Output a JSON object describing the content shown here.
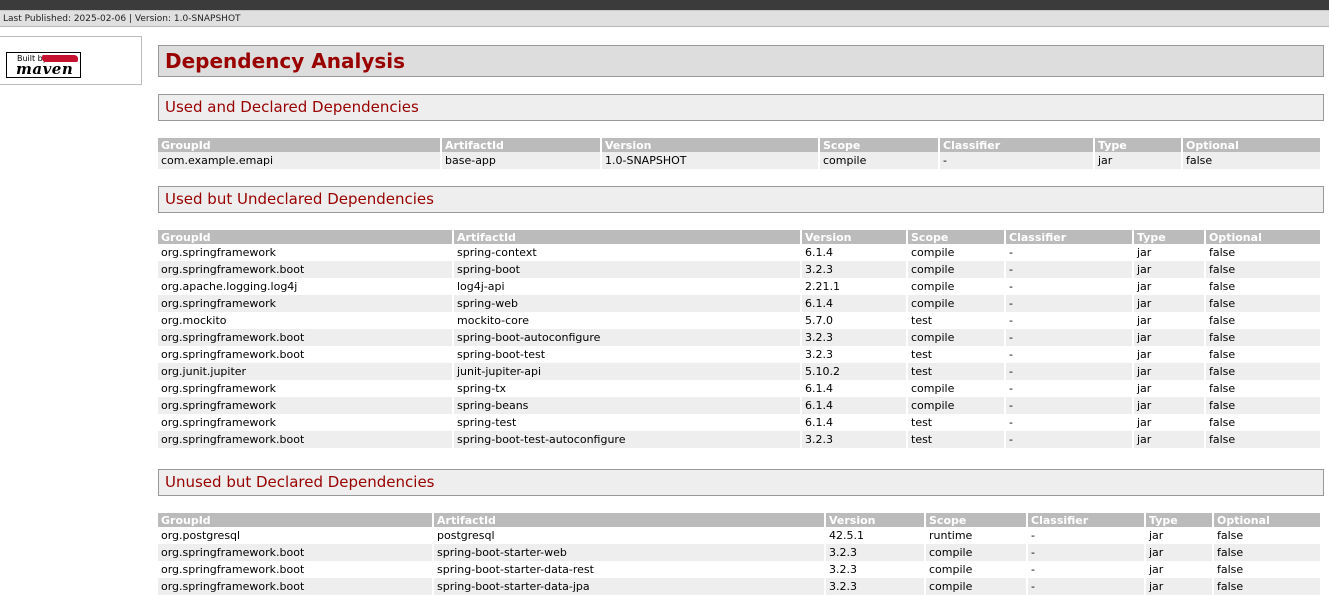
{
  "header": {
    "published": "Last Published: 2025-02-06 | Version: 1.0-SNAPSHOT"
  },
  "badge": {
    "built_by": "Built by:",
    "word": "maven"
  },
  "page_title": "Dependency Analysis",
  "columns": [
    "GroupId",
    "ArtifactId",
    "Version",
    "Scope",
    "Classifier",
    "Type",
    "Optional"
  ],
  "sections": [
    {
      "title": "Used and Declared Dependencies",
      "rows": [
        [
          "com.example.emapi",
          "base-app",
          "1.0-SNAPSHOT",
          "compile",
          "-",
          "jar",
          "false"
        ]
      ]
    },
    {
      "title": "Used but Undeclared Dependencies",
      "rows": [
        [
          "org.springframework",
          "spring-context",
          "6.1.4",
          "compile",
          "-",
          "jar",
          "false"
        ],
        [
          "org.springframework.boot",
          "spring-boot",
          "3.2.3",
          "compile",
          "-",
          "jar",
          "false"
        ],
        [
          "org.apache.logging.log4j",
          "log4j-api",
          "2.21.1",
          "compile",
          "-",
          "jar",
          "false"
        ],
        [
          "org.springframework",
          "spring-web",
          "6.1.4",
          "compile",
          "-",
          "jar",
          "false"
        ],
        [
          "org.mockito",
          "mockito-core",
          "5.7.0",
          "test",
          "-",
          "jar",
          "false"
        ],
        [
          "org.springframework.boot",
          "spring-boot-autoconfigure",
          "3.2.3",
          "compile",
          "-",
          "jar",
          "false"
        ],
        [
          "org.springframework.boot",
          "spring-boot-test",
          "3.2.3",
          "test",
          "-",
          "jar",
          "false"
        ],
        [
          "org.junit.jupiter",
          "junit-jupiter-api",
          "5.10.2",
          "test",
          "-",
          "jar",
          "false"
        ],
        [
          "org.springframework",
          "spring-tx",
          "6.1.4",
          "compile",
          "-",
          "jar",
          "false"
        ],
        [
          "org.springframework",
          "spring-beans",
          "6.1.4",
          "compile",
          "-",
          "jar",
          "false"
        ],
        [
          "org.springframework",
          "spring-test",
          "6.1.4",
          "test",
          "-",
          "jar",
          "false"
        ],
        [
          "org.springframework.boot",
          "spring-boot-test-autoconfigure",
          "3.2.3",
          "test",
          "-",
          "jar",
          "false"
        ]
      ]
    },
    {
      "title": "Unused but Declared Dependencies",
      "rows": [
        [
          "org.postgresql",
          "postgresql",
          "42.5.1",
          "runtime",
          "-",
          "jar",
          "false"
        ],
        [
          "org.springframework.boot",
          "spring-boot-starter-web",
          "3.2.3",
          "compile",
          "-",
          "jar",
          "false"
        ],
        [
          "org.springframework.boot",
          "spring-boot-starter-data-rest",
          "3.2.3",
          "compile",
          "-",
          "jar",
          "false"
        ],
        [
          "org.springframework.boot",
          "spring-boot-starter-data-jpa",
          "3.2.3",
          "compile",
          "-",
          "jar",
          "false"
        ]
      ]
    }
  ]
}
